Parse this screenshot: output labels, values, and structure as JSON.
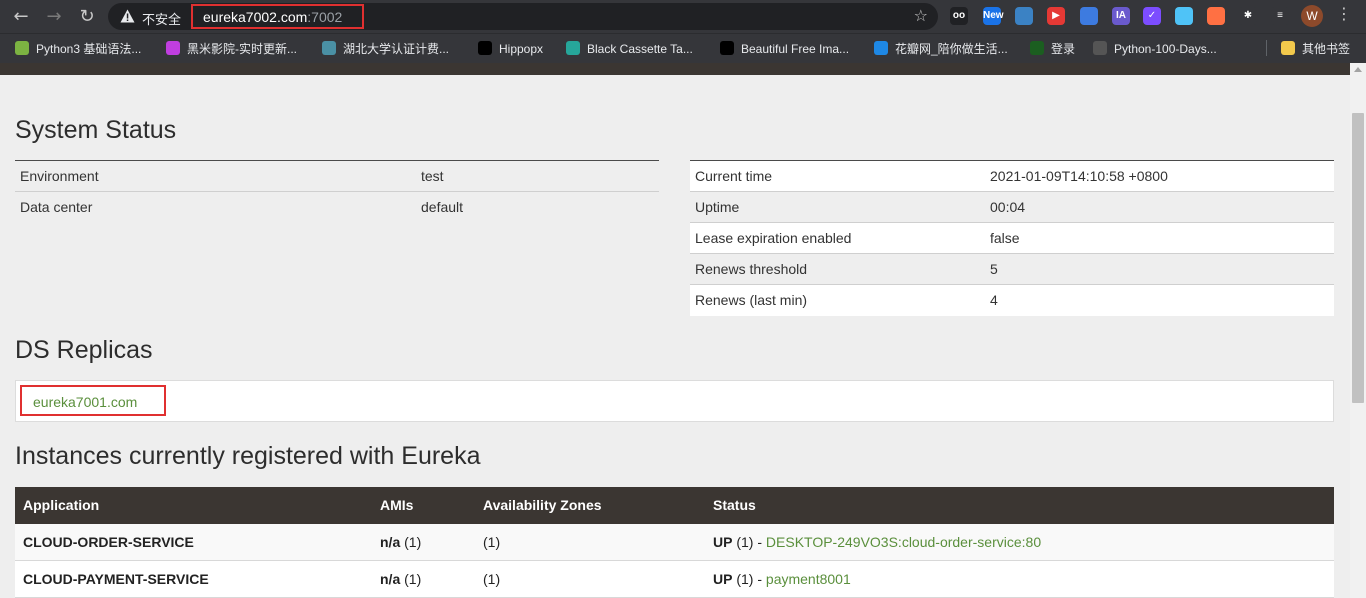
{
  "browser": {
    "insecure_label": "不安全",
    "url_host": "eureka7002.com",
    "url_port": ":7002",
    "extensions": [
      {
        "icon": "glasses-icon",
        "color": "#202124",
        "text": "oo"
      },
      {
        "icon": "new-badge-icon",
        "color": "#1a73e8",
        "text": "New"
      },
      {
        "icon": "colorful-icon",
        "color": "#3b82c4",
        "text": ""
      },
      {
        "icon": "youtube-icon",
        "color": "#e53935",
        "text": "▶"
      },
      {
        "icon": "baidu-icon",
        "color": "#3d7be0",
        "text": ""
      },
      {
        "icon": "ia-icon",
        "color": "#6a5acd",
        "text": "IA"
      },
      {
        "icon": "check-icon",
        "color": "#7c4dff",
        "text": "✓"
      },
      {
        "icon": "search-badge-icon",
        "color": "#4fc3f7",
        "text": ""
      },
      {
        "icon": "grid-icon",
        "color": "#ff7043",
        "text": ""
      },
      {
        "icon": "puzzle-icon",
        "color": "#35363a",
        "text": "✱"
      },
      {
        "icon": "playlist-icon",
        "color": "#35363a",
        "text": "≡"
      }
    ],
    "avatar_letter": "W",
    "bookmarks": [
      {
        "label": "Python3 基础语法...",
        "color": "#7cb342"
      },
      {
        "label": "黑米影院-实时更新...",
        "color": "#c03ee0"
      },
      {
        "label": "湖北大学认证计费...",
        "color": "#4a90a4"
      },
      {
        "label": "Hippopx",
        "color": "#000000"
      },
      {
        "label": "Black Cassette Ta...",
        "color": "#26a69a"
      },
      {
        "label": "Beautiful Free Ima...",
        "color": "#000000"
      },
      {
        "label": "花瓣网_陪你做生活...",
        "color": "#1e88e5"
      },
      {
        "label": "登录",
        "color": "#1b5e20"
      },
      {
        "label": "Python-100-Days...",
        "color": "#555555"
      }
    ],
    "other_bookmarks": "其他书签"
  },
  "system_status": {
    "title": "System Status",
    "left": [
      {
        "key": "Environment",
        "value": "test"
      },
      {
        "key": "Data center",
        "value": "default"
      }
    ],
    "right": [
      {
        "key": "Current time",
        "value": "2021-01-09T14:10:58 +0800"
      },
      {
        "key": "Uptime",
        "value": "00:04"
      },
      {
        "key": "Lease expiration enabled",
        "value": "false"
      },
      {
        "key": "Renews threshold",
        "value": "5"
      },
      {
        "key": "Renews (last min)",
        "value": "4"
      }
    ]
  },
  "ds_replicas": {
    "title": "DS Replicas",
    "replica": "eureka7001.com"
  },
  "instances": {
    "title": "Instances currently registered with Eureka",
    "headers": [
      "Application",
      "AMIs",
      "Availability Zones",
      "Status"
    ],
    "rows": [
      {
        "application": "CLOUD-ORDER-SERVICE",
        "ami_bold": "n/a",
        "ami_count": "(1)",
        "zones": "(1)",
        "status": "UP",
        "status_count": "(1) -",
        "instance": "DESKTOP-249VO3S:cloud-order-service:80"
      },
      {
        "application": "CLOUD-PAYMENT-SERVICE",
        "ami_bold": "n/a",
        "ami_count": "(1)",
        "zones": "(1)",
        "status": "UP",
        "status_count": "(1) -",
        "instance": "payment8001"
      }
    ]
  }
}
